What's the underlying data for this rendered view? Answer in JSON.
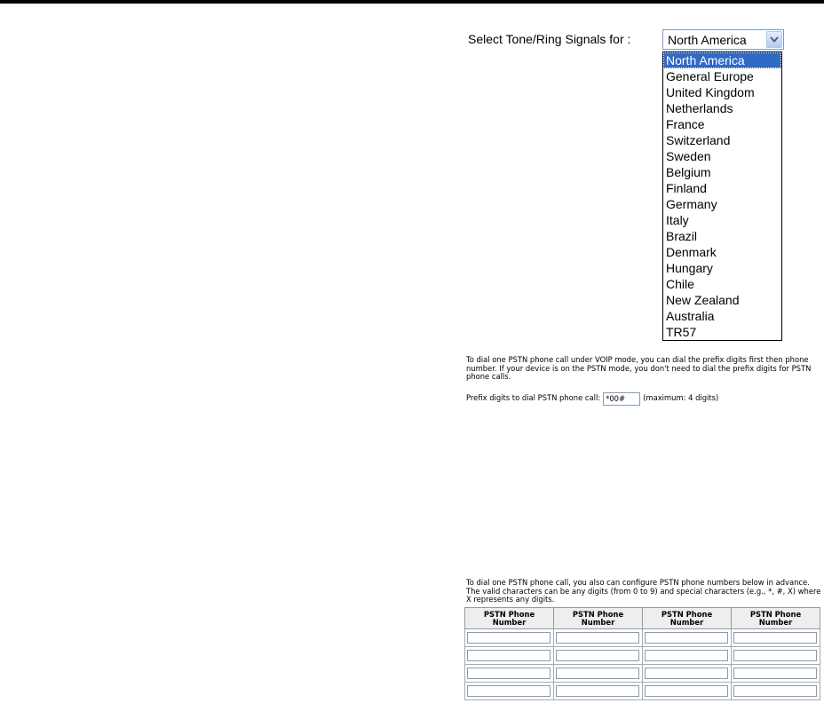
{
  "tone": {
    "label": "Select Tone/Ring Signals for :",
    "selected": "North America",
    "options": [
      "North America",
      "General Europe",
      "United Kingdom",
      "Netherlands",
      "France",
      "Switzerland",
      "Sweden",
      "Belgium",
      "Finland",
      "Germany",
      "Italy",
      "Brazil",
      "Denmark",
      "Hungary",
      "Chile",
      "New Zealand",
      "Australia",
      "TR57"
    ]
  },
  "prefix": {
    "intro": "To dial one PSTN phone call under VOIP mode, you can dial the prefix digits first then phone number. If your device is on the PSTN mode, you don't need to dial the prefix digits for PSTN phone calls.",
    "label": "Prefix digits to dial PSTN phone call:",
    "value": "*00#",
    "hint": "(maximum: 4 digits)"
  },
  "pstn": {
    "intro": "To dial one PSTN phone call, you also can configure PSTN phone numbers below in advance. The valid characters can be any digits (from 0 to 9) and special characters (e.g., *, #, X) where X represents any digits.",
    "headers": [
      "PSTN Phone Number",
      "PSTN Phone Number",
      "PSTN Phone Number",
      "PSTN Phone Number"
    ],
    "rows": [
      [
        "",
        "",
        "",
        ""
      ],
      [
        "",
        "",
        "",
        ""
      ],
      [
        "",
        "",
        "",
        ""
      ],
      [
        "",
        "",
        "",
        ""
      ]
    ]
  }
}
